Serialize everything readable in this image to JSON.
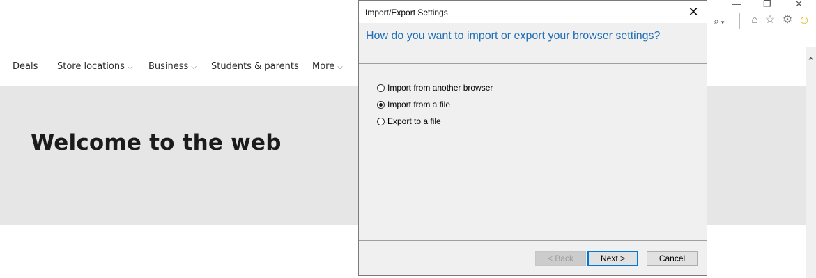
{
  "browser": {
    "search_icon": "search-icon",
    "window_controls": {
      "minimize": "—",
      "restore": "❐",
      "close": "✕"
    },
    "toolbar_icons": [
      "home-icon",
      "star-icon",
      "gear-icon",
      "smiley-icon"
    ]
  },
  "nav": {
    "items": [
      {
        "label": "Deals",
        "has_dropdown": false
      },
      {
        "label": "Store locations",
        "has_dropdown": true
      },
      {
        "label": "Business",
        "has_dropdown": true
      },
      {
        "label": "Students & parents",
        "has_dropdown": false
      },
      {
        "label": "More",
        "has_dropdown": true
      }
    ]
  },
  "hero": {
    "title": "Welcome to the web"
  },
  "dialog": {
    "title": "Import/Export Settings",
    "question": "How do you want to import or export your browser settings?",
    "options": [
      {
        "label": "Import from another browser",
        "checked": false
      },
      {
        "label": "Import from a file",
        "checked": true
      },
      {
        "label": "Export to a file",
        "checked": false
      }
    ],
    "buttons": {
      "back": "< Back",
      "next": "Next >",
      "cancel": "Cancel"
    }
  },
  "colors": {
    "accent": "#1e6fb5",
    "hero_bg": "#e6e6e6",
    "dialog_bg": "#f0f0f0",
    "focus": "#0078d7"
  }
}
